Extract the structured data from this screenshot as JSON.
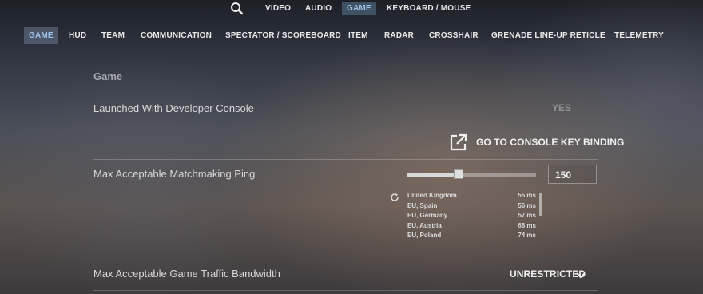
{
  "top_nav": {
    "search_icon": "search-icon",
    "items": [
      {
        "label": "VIDEO",
        "active": false
      },
      {
        "label": "AUDIO",
        "active": false
      },
      {
        "label": "GAME",
        "active": true
      },
      {
        "label": "KEYBOARD / MOUSE",
        "active": false
      }
    ]
  },
  "sub_nav": {
    "items": [
      {
        "label": "GAME",
        "active": true
      },
      {
        "label": "HUD",
        "active": false
      },
      {
        "label": "TEAM",
        "active": false
      },
      {
        "label": "COMMUNICATION",
        "active": false
      },
      {
        "label": "SPECTATOR / SCOREBOARD",
        "active": false
      },
      {
        "label": "ITEM",
        "active": false
      },
      {
        "label": "RADAR",
        "active": false
      },
      {
        "label": "CROSSHAIR",
        "active": false
      },
      {
        "label": "GRENADE LINE-UP RETICLE",
        "active": false
      },
      {
        "label": "TELEMETRY",
        "active": false
      }
    ]
  },
  "section": {
    "title": "Game"
  },
  "settings": {
    "dev_console": {
      "label": "Launched With Developer Console",
      "value": "YES"
    },
    "console_link": {
      "label": "GO TO CONSOLE KEY BINDING",
      "icon": "external-link-icon"
    },
    "ping": {
      "label": "Max Acceptable Matchmaking Ping",
      "value": "150",
      "slider_fraction": 0.4,
      "servers": [
        {
          "name": "United Kingdom",
          "ping": "55 ms"
        },
        {
          "name": "EU, Spain",
          "ping": "56 ms"
        },
        {
          "name": "EU, Germany",
          "ping": "57 ms"
        },
        {
          "name": "EU, Austria",
          "ping": "68 ms"
        },
        {
          "name": "EU, Poland",
          "ping": "74 ms"
        }
      ]
    },
    "bandwidth": {
      "label": "Max Acceptable Game Traffic Bandwidth",
      "value": "UNRESTRICTED"
    }
  },
  "colors": {
    "accent": "#9ec3e6",
    "active_bg": "#5a7896"
  }
}
